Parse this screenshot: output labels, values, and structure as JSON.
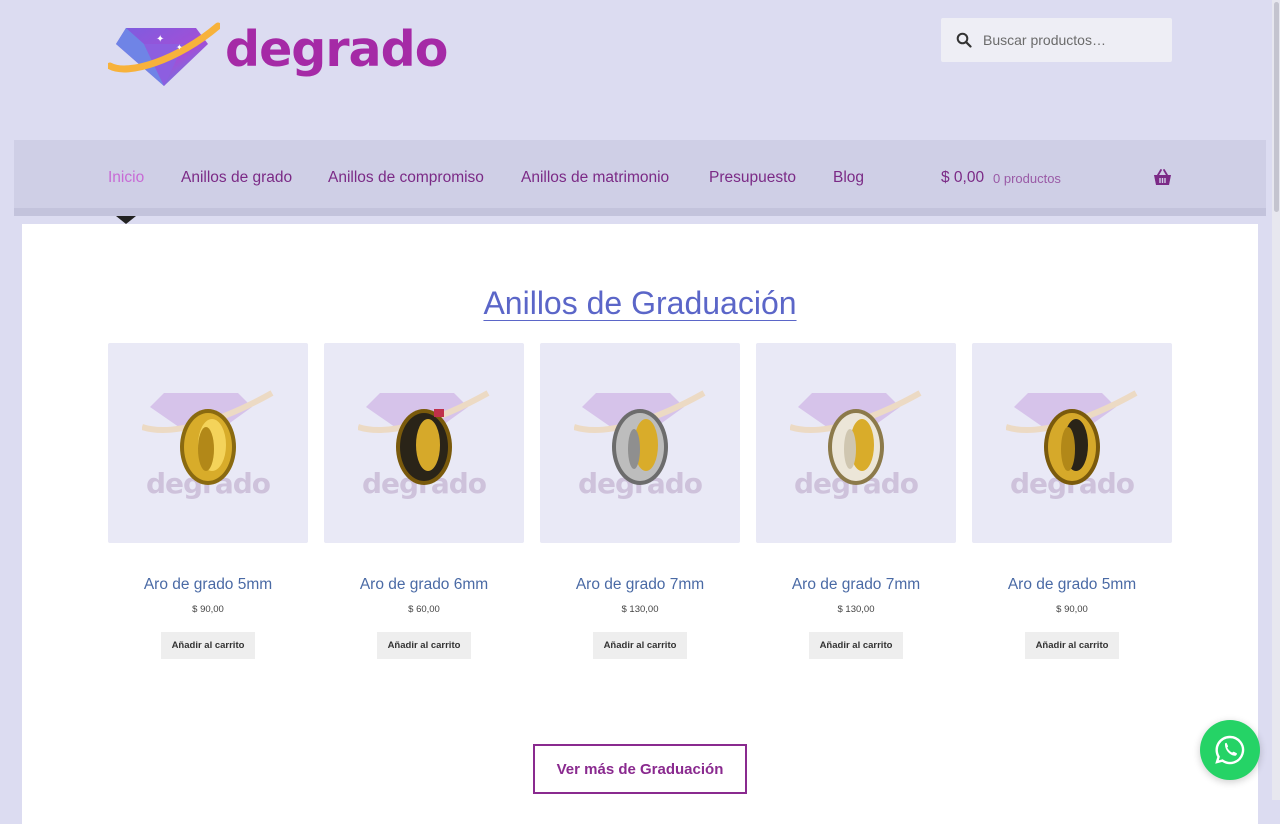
{
  "brand": {
    "name": "degrado"
  },
  "search": {
    "placeholder": "Buscar productos…"
  },
  "nav": {
    "items": [
      {
        "label": "Inicio"
      },
      {
        "label": "Anillos de grado"
      },
      {
        "label": "Anillos de compromiso"
      },
      {
        "label": "Anillos de matrimonio"
      },
      {
        "label": "Presupuesto"
      },
      {
        "label": "Blog"
      }
    ],
    "cart_total": "$ 0,00",
    "cart_count": "0 productos"
  },
  "section": {
    "title": "Anillos de Graduación",
    "products": [
      {
        "name": "Aro de grado 5mm",
        "price": "$ 90,00",
        "button": "Añadir al carrito",
        "ring": "gold"
      },
      {
        "name": "Aro de grado 6mm",
        "price": "$ 60,00",
        "button": "Añadir al carrito",
        "ring": "gold-black"
      },
      {
        "name": "Aro de grado 7mm",
        "price": "$ 130,00",
        "button": "Añadir al carrito",
        "ring": "silver-gold"
      },
      {
        "name": "Aro de grado 7mm",
        "price": "$ 130,00",
        "button": "Añadir al carrito",
        "ring": "white-gold"
      },
      {
        "name": "Aro de grado 5mm",
        "price": "$ 90,00",
        "button": "Añadir al carrito",
        "ring": "gold-black"
      }
    ],
    "more_button": "Ver más de Graduación"
  },
  "colors": {
    "brand_purple": "#a52aa6",
    "nav_text": "#7b2a86",
    "nav_active": "#c86ad5",
    "title_blue": "#5b66c8",
    "whatsapp_green": "#25d366"
  },
  "icons": [
    "search-icon",
    "basket-icon",
    "whatsapp-icon",
    "gem-logo-icon",
    "ring-image"
  ]
}
